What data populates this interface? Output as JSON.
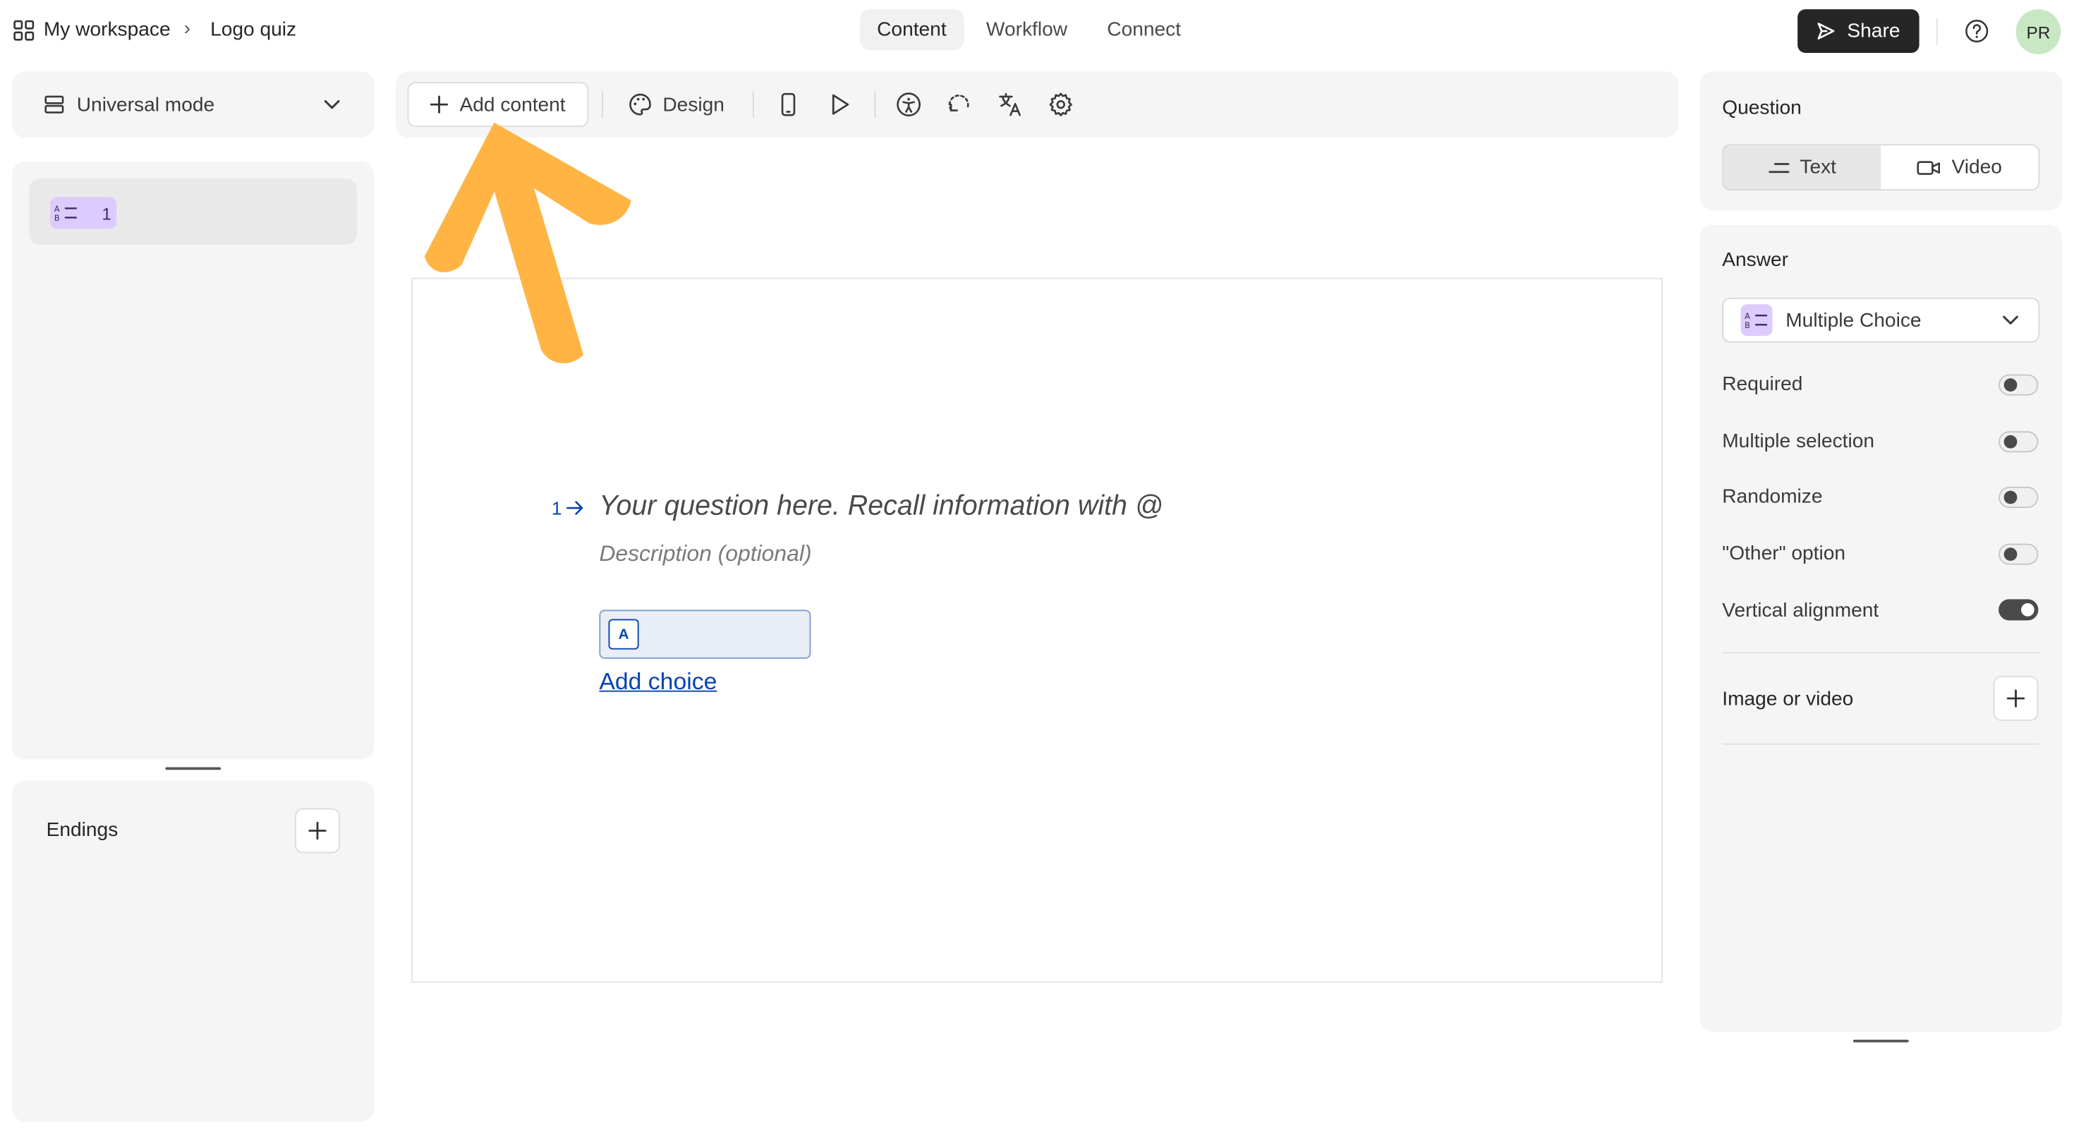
{
  "breadcrumb": {
    "workspace": "My workspace",
    "separator": "›",
    "form": "Logo quiz"
  },
  "nav": {
    "tabs": [
      "Content",
      "Workflow",
      "Connect"
    ],
    "active": "Content"
  },
  "header": {
    "share_label": "Share",
    "avatar_initials": "PR"
  },
  "left": {
    "mode_label": "Universal mode",
    "questions": [
      {
        "number": "1",
        "type_icon": "multiple-choice-icon"
      }
    ],
    "endings_label": "Endings"
  },
  "toolbar": {
    "add_content_label": "Add content",
    "design_label": "Design"
  },
  "canvas": {
    "question_number": "1",
    "question_placeholder": "Your question here. Recall information with @",
    "description_placeholder": "Description (optional)",
    "choice_key": "A",
    "add_choice_label": "Add choice"
  },
  "right": {
    "question_heading": "Question",
    "question_tabs": [
      "Text",
      "Video"
    ],
    "answer_heading": "Answer",
    "answer_type": "Multiple Choice",
    "settings": [
      {
        "label": "Required",
        "on": false
      },
      {
        "label": "Multiple selection",
        "on": false
      },
      {
        "label": "Randomize",
        "on": false
      },
      {
        "label": "\"Other\" option",
        "on": false
      },
      {
        "label": "Vertical alignment",
        "on": true
      }
    ],
    "media_label": "Image or video"
  },
  "colors": {
    "accent_arrow": "#ffb444",
    "link": "#0445af",
    "choice_bg": "#e8edf6",
    "primary_dark": "#262627",
    "avatar_green": "#c7e8c3"
  }
}
